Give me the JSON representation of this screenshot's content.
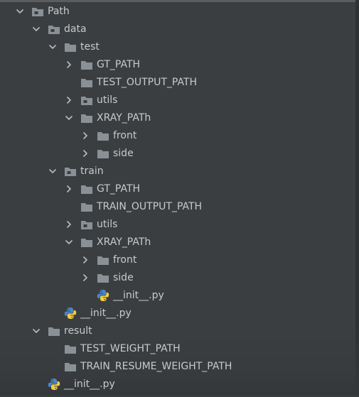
{
  "colors": {
    "background": "#3b3e41",
    "text": "#c8cacc",
    "folder": "#8a9196",
    "python_blue": "#4a86c8",
    "python_yellow": "#f2cd43"
  },
  "tree": [
    {
      "label": "Path",
      "icon": "module-folder-icon",
      "arrow": "expanded",
      "depth": 0
    },
    {
      "label": "data",
      "icon": "module-folder-icon",
      "arrow": "expanded",
      "depth": 1
    },
    {
      "label": "test",
      "icon": "folder-icon",
      "arrow": "expanded",
      "depth": 2
    },
    {
      "label": "GT_PATH",
      "icon": "folder-icon",
      "arrow": "collapsed",
      "depth": 3
    },
    {
      "label": "TEST_OUTPUT_PATH",
      "icon": "folder-icon",
      "arrow": "none",
      "depth": 3
    },
    {
      "label": "utils",
      "icon": "module-folder-icon",
      "arrow": "collapsed",
      "depth": 3
    },
    {
      "label": "XRAY_PATh",
      "icon": "folder-icon",
      "arrow": "expanded",
      "depth": 3
    },
    {
      "label": "front",
      "icon": "folder-icon",
      "arrow": "collapsed",
      "depth": 4
    },
    {
      "label": "side",
      "icon": "folder-icon",
      "arrow": "collapsed",
      "depth": 4
    },
    {
      "label": "train",
      "icon": "module-folder-icon",
      "arrow": "expanded",
      "depth": 2
    },
    {
      "label": "GT_PATH",
      "icon": "folder-icon",
      "arrow": "collapsed",
      "depth": 3
    },
    {
      "label": "TRAIN_OUTPUT_PATH",
      "icon": "folder-icon",
      "arrow": "none",
      "depth": 3
    },
    {
      "label": "utils",
      "icon": "module-folder-icon",
      "arrow": "collapsed",
      "depth": 3
    },
    {
      "label": "XRAY_PATh",
      "icon": "folder-icon",
      "arrow": "expanded",
      "depth": 3
    },
    {
      "label": "front",
      "icon": "folder-icon",
      "arrow": "collapsed",
      "depth": 4
    },
    {
      "label": "side",
      "icon": "folder-icon",
      "arrow": "collapsed",
      "depth": 4
    },
    {
      "label": "__init__.py",
      "icon": "python-file-icon",
      "arrow": "none",
      "depth": 4
    },
    {
      "label": "__init__.py",
      "icon": "python-file-icon",
      "arrow": "none",
      "depth": 2
    },
    {
      "label": "result",
      "icon": "folder-icon",
      "arrow": "expanded",
      "depth": 1
    },
    {
      "label": "TEST_WEIGHT_PATH",
      "icon": "folder-icon",
      "arrow": "none",
      "depth": 2
    },
    {
      "label": "TRAIN_RESUME_WEIGHT_PATH",
      "icon": "folder-icon",
      "arrow": "none",
      "depth": 2
    },
    {
      "label": "__init__.py",
      "icon": "python-file-icon",
      "arrow": "none",
      "depth": 1
    }
  ]
}
